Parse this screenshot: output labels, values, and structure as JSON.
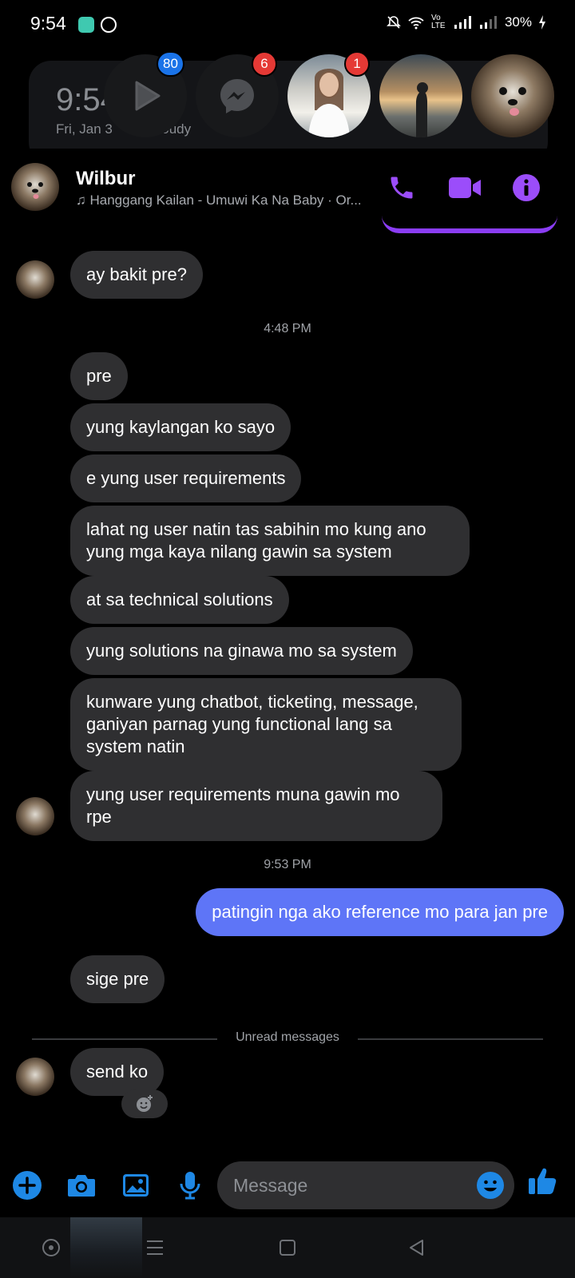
{
  "status_bar": {
    "time": "9:54",
    "battery": "30%",
    "volte": "Vo LTE"
  },
  "background": {
    "clock": "9:54",
    "date": "Fri, Jan 3      ly Cloudy"
  },
  "chat_heads": [
    {
      "name": "play-app",
      "badge": "80",
      "badge_color": "#1a73e8"
    },
    {
      "name": "messenger",
      "badge": "6",
      "badge_color": "#e53935"
    },
    {
      "name": "contact-girl-white-dress",
      "badge": "1",
      "badge_color": "#e53935"
    },
    {
      "name": "contact-beach-sunset",
      "badge": null
    },
    {
      "name": "contact-dog",
      "badge": null
    }
  ],
  "header": {
    "name": "Wilbur",
    "subtitle": "Hanggang Kailan - Umuwi Ka Na Baby · Or..."
  },
  "messages": [
    {
      "text": "ay bakit pre?"
    },
    {
      "timestamp": "4:48 PM"
    },
    {
      "text": "pre"
    },
    {
      "text": "yung kaylangan ko sayo"
    },
    {
      "text": "e yung user requirements"
    },
    {
      "text": "lahat ng user natin tas sabihin mo kung ano yung mga kaya nilang gawin sa system"
    },
    {
      "text": "at sa technical solutions"
    },
    {
      "text": "yung solutions na ginawa mo sa system"
    },
    {
      "text": "kunware yung chatbot, ticketing, message, ganiyan parnag yung functional lang sa system natin"
    },
    {
      "text": "yung user requirements muna gawin mo rpe"
    },
    {
      "timestamp": "9:53 PM"
    },
    {
      "text": "patingin nga ako reference mo para jan pre"
    },
    {
      "text": "sige pre"
    },
    {
      "divider": "Unread messages"
    },
    {
      "text": "send ko"
    }
  ],
  "composer": {
    "placeholder": "Message"
  },
  "colors": {
    "accent_purple": "#9b4dfa",
    "own_bubble": "#5e75f7",
    "other_bubble": "#2f2f31",
    "composer_blue": "#1e88e5"
  }
}
